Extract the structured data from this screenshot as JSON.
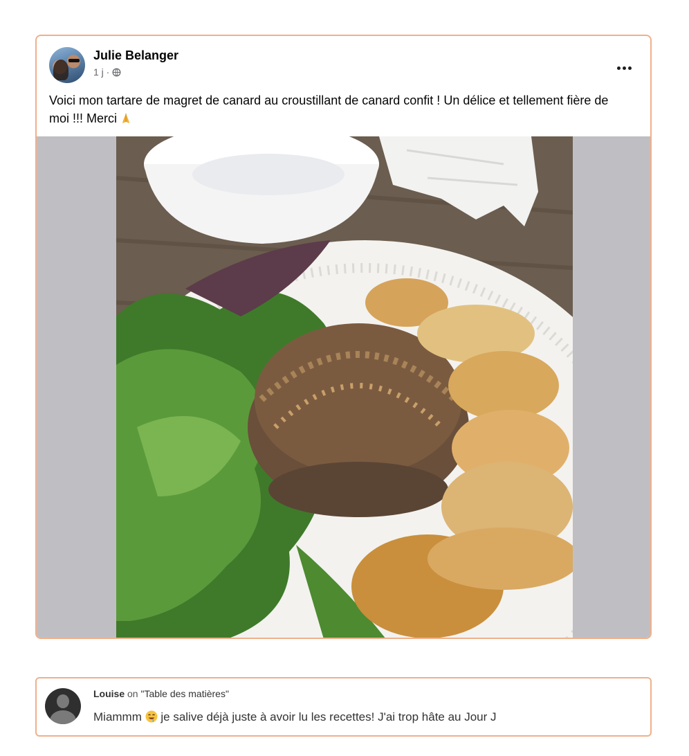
{
  "post": {
    "author": "Julie Belanger",
    "time": "1 j ·",
    "privacy_icon": "globe-icon",
    "text": "Voici mon tartare de magret de canard au croustillant de canard confit ! Un délice et tellement fière de moi !!! Merci",
    "text_emoji": "pray-icon",
    "more_icon": "more-dots-icon"
  },
  "comment": {
    "author": "Louise",
    "on_word": "on",
    "reference": "\"Table des matières\"",
    "text_before_emoji": "Miammm",
    "emoji": "drooling-face-icon",
    "text_after_emoji": "je salive déjà juste à avoir lu les recettes! J'ai trop hâte au Jour J"
  },
  "colors": {
    "card_border": "#f0b08a",
    "media_background": "#bfbfc3",
    "text_primary": "#050505",
    "text_secondary": "#65676b"
  }
}
